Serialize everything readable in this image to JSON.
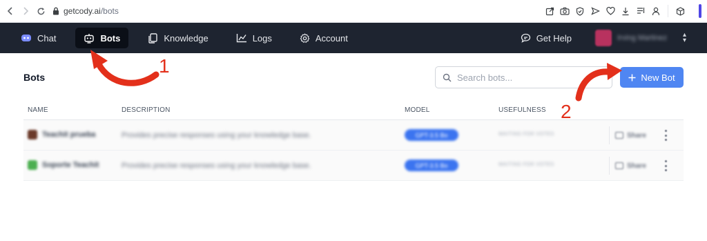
{
  "browser": {
    "url_domain": "getcody.ai",
    "url_path": "/bots"
  },
  "nav": {
    "items": [
      {
        "label": "Chat",
        "icon": "chat-bot-icon"
      },
      {
        "label": "Bots",
        "icon": "bot-icon",
        "active": true
      },
      {
        "label": "Knowledge",
        "icon": "documents-icon"
      },
      {
        "label": "Logs",
        "icon": "chart-icon"
      },
      {
        "label": "Account",
        "icon": "gear-icon"
      }
    ],
    "help_label": "Get Help",
    "user_name": "Irving Martinez"
  },
  "page": {
    "title": "Bots",
    "search_placeholder": "Search bots...",
    "new_bot_label": "New Bot"
  },
  "table": {
    "headers": [
      "NAME",
      "DESCRIPTION",
      "MODEL",
      "USEFULNESS"
    ],
    "rows": [
      {
        "name": "Teachit prueba",
        "description": "Provides precise responses using your knowledge base.",
        "model": "GPT-3.5 Bo",
        "usefulness": "WAITING FOR VOTES",
        "share": "Share",
        "avatar_color": "#6b3a2a"
      },
      {
        "name": "Soporte Teachit",
        "description": "Provides precise responses using your knowledge base.",
        "model": "GPT-3.5 Bo",
        "usefulness": "WAITING FOR VOTES",
        "share": "Share",
        "avatar_color": "#4caf50"
      }
    ]
  },
  "annotations": {
    "step1": "1",
    "step2": "2",
    "color": "#e3301b"
  },
  "colors": {
    "nav_bg": "#1e2430",
    "primary_button": "#4f86f2",
    "model_pill": "#3b74f0"
  }
}
